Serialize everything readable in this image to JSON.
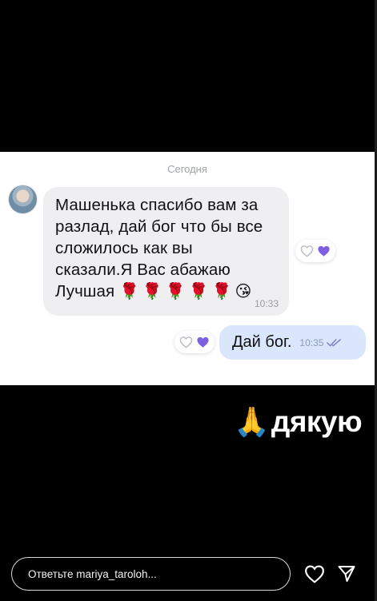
{
  "chat": {
    "date_label": "Сегодня",
    "incoming": {
      "text": "Машенька спасибо вам за\nразлад, дай бог что бы все\nсложилось как вы\nсказали.Я Вас абажаю\nЛучшая",
      "roses": "🌹🌹🌹🌹🌹",
      "emoji": "😘",
      "time": "10:33"
    },
    "outgoing": {
      "text": "Дай бог.",
      "time": "10:35"
    },
    "reaction_colors": {
      "filled": "#7d5fe0",
      "outline": "#b9bcc3"
    }
  },
  "story": {
    "caption_emoji": "🙏",
    "caption_text": "дякую",
    "reply_placeholder": "Ответьте mariya_taroloh..."
  },
  "icons": {
    "like": "heart-outline-icon",
    "share": "paper-plane-icon"
  }
}
